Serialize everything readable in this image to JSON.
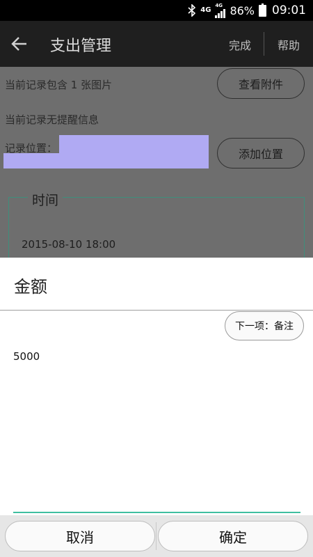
{
  "status_bar": {
    "network_1": "4G",
    "network_2": "4G",
    "battery": "86%",
    "time": "09:01",
    "icons": [
      "bluetooth-icon",
      "signal-icon",
      "battery-icon"
    ]
  },
  "header": {
    "back_icon": "arrow-left-icon",
    "title": "支出管理",
    "done_label": "完成",
    "help_label": "帮助"
  },
  "record": {
    "attachment_text": "当前记录包含 1 张图片",
    "view_attachment_label": "查看附件",
    "reminder_text": "当前记录无提醒信息",
    "location_label": "记录位置：",
    "add_location_label": "添加位置",
    "time_legend": "时间",
    "time_value": "2015-08-10 18:00"
  },
  "dialog": {
    "title": "金额",
    "next_label": "下一项：备注",
    "amount_value": "5000"
  },
  "buttons": {
    "cancel_label": "取消",
    "confirm_label": "确定"
  },
  "colors": {
    "accent": "#3fbfa1",
    "location_highlight": "#b0aaf3",
    "header_bg": "#1f1f1f",
    "dim_overlay": "#6e6e6e"
  }
}
